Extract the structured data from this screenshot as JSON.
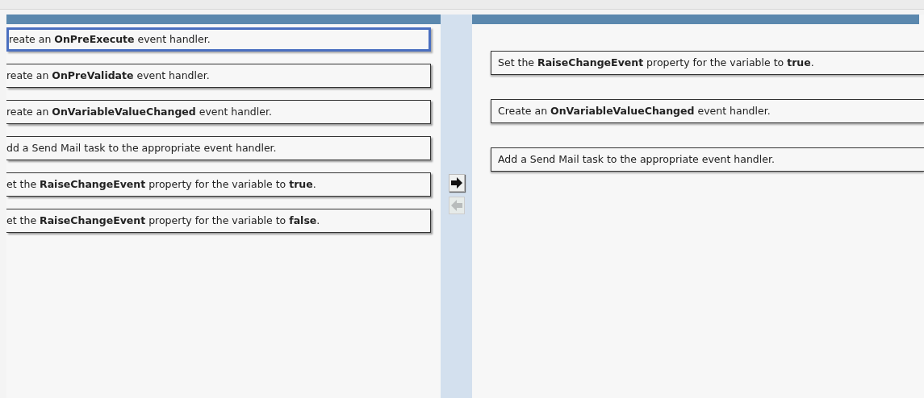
{
  "left_list": {
    "items": [
      {
        "text": "reate an **OnPreExecute** event handler.",
        "selected": true
      },
      {
        "text": "reate an **OnPreValidate** event handler.",
        "selected": false
      },
      {
        "text": "reate an **OnVariableValueChanged** event handler.",
        "selected": false
      },
      {
        "text": "dd a Send Mail task to the appropriate event handler.",
        "selected": false
      },
      {
        "text": "et the **RaiseChangeEvent** property for the variable to **true**.",
        "selected": false
      },
      {
        "text": "et the **RaiseChangeEvent** property for the variable to **false**.",
        "selected": false
      }
    ]
  },
  "move_buttons": [
    {
      "kind": "right",
      "disabled": false
    },
    {
      "kind": "left",
      "disabled": true
    }
  ],
  "right_list": {
    "items": [
      {
        "text": "Set the **RaiseChangeEvent** property for the variable to **true**."
      },
      {
        "text": "Create an **OnVariableValueChanged** event handler."
      },
      {
        "text": "Add a Send Mail task to the appropriate event handler."
      }
    ]
  }
}
